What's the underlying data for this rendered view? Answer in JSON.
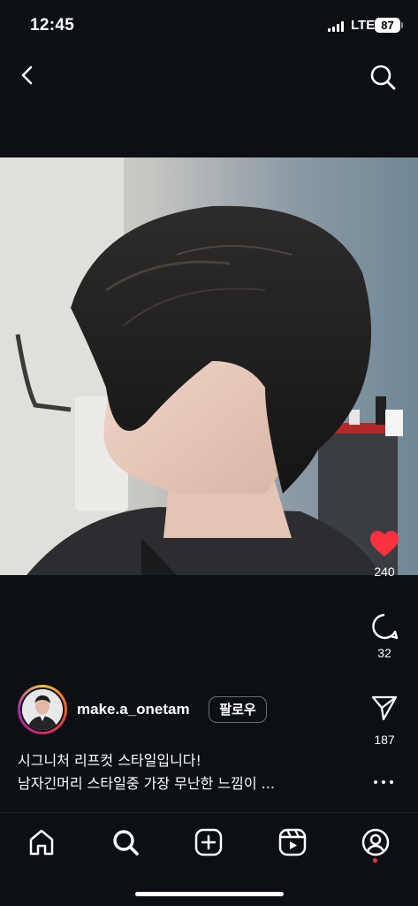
{
  "status_bar": {
    "time": "12:45",
    "network": "LTE",
    "battery": "87"
  },
  "nav": {
    "back_icon": "chevron-left-icon",
    "search_icon": "search-icon"
  },
  "post": {
    "media_description_icon": "reel-photo",
    "like_count": "240",
    "comment_count": "32",
    "share_count": "187",
    "author": {
      "username": "make.a_onetam",
      "follow_label": "팔로우"
    },
    "caption_lines": [
      "시그니처 리프컷 스타일입니다!",
      "남자긴머리 스타일중 가장 무난한 느낌이 ..."
    ]
  },
  "tabbar": {
    "items": [
      "home-icon",
      "search-icon",
      "create-icon",
      "reels-icon",
      "profile-icon"
    ]
  },
  "colors": {
    "background": "#0c0f14",
    "like_red": "#ff3040",
    "text": "#ffffff"
  }
}
